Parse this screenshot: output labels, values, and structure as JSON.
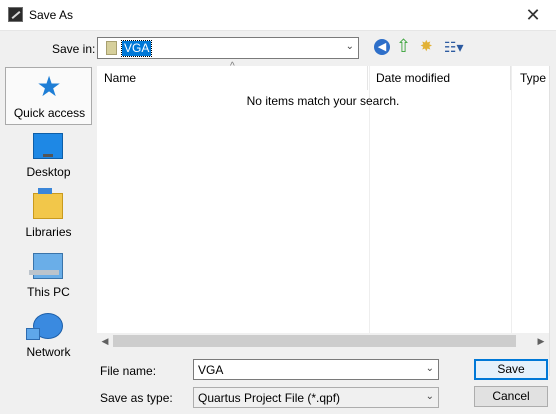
{
  "window": {
    "title": "Save As",
    "close_glyph": "✕"
  },
  "location": {
    "label": "Save in:",
    "value": "VGA"
  },
  "toolbar": {
    "back_glyph": "◀",
    "up_glyph": "⇧",
    "newfolder_glyph": "✸",
    "view_glyph": "☷▾"
  },
  "places": [
    {
      "label": "Quick access",
      "icon": "star-icon"
    },
    {
      "label": "Desktop",
      "icon": "desktop-icon"
    },
    {
      "label": "Libraries",
      "icon": "libraries-icon"
    },
    {
      "label": "This PC",
      "icon": "this-pc-icon"
    },
    {
      "label": "Network",
      "icon": "network-icon"
    }
  ],
  "filelist": {
    "columns": [
      "Name",
      "Date modified",
      "Type"
    ],
    "empty_message": "No items match your search."
  },
  "form": {
    "filename_label": "File name:",
    "filename_value": "VGA",
    "type_label": "Save as type:",
    "type_value": "Quartus Project File (*.qpf)"
  },
  "buttons": {
    "save": "Save",
    "cancel": "Cancel"
  },
  "colors": {
    "selection": "#0078d7",
    "accent_icon": "#1e7ed6"
  }
}
